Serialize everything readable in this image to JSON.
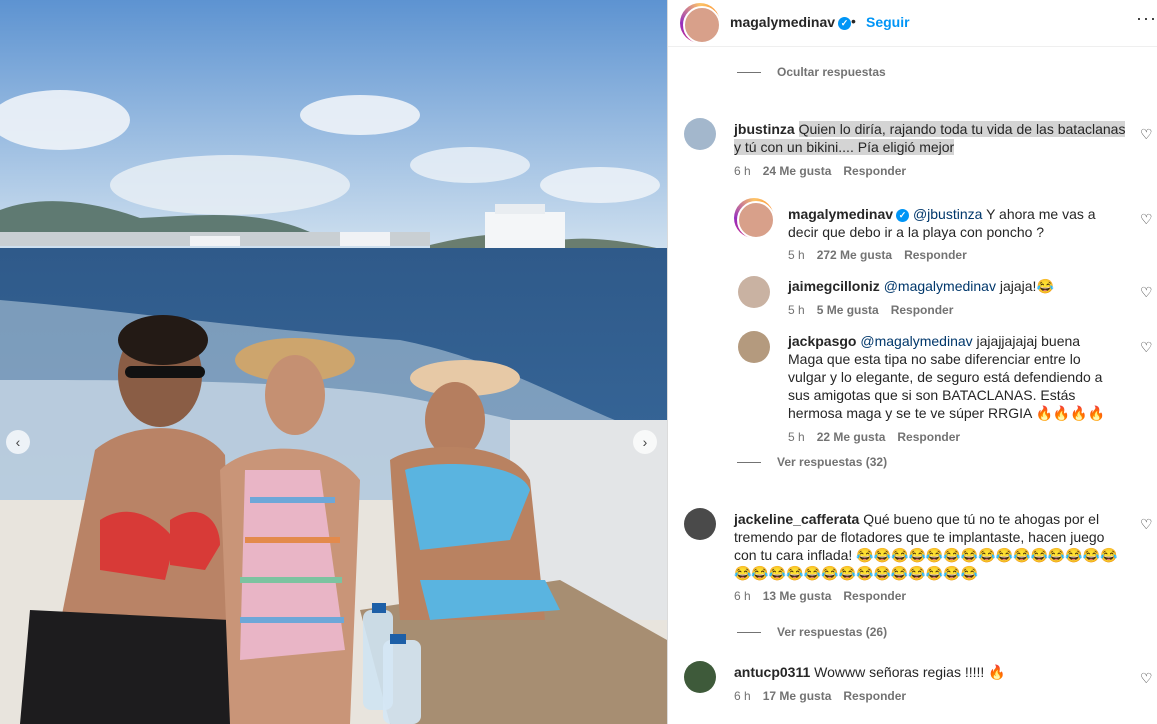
{
  "header": {
    "username": "magalymedinav",
    "dot": "•",
    "follow": "Seguir",
    "more": "···"
  },
  "hide_replies": "Ocultar respuestas",
  "comments": [
    {
      "username": "jbustinza",
      "text": "Quien lo diría, rajando toda tu vida de las bataclanas y tú con un bikini.... Pía eligió mejor",
      "time": "6 h",
      "likes": "24 Me gusta",
      "reply": "Responder"
    },
    {
      "username": "magalymedinav",
      "mention": "@jbustinza",
      "text": "Y ahora me vas a decir que debo ir a la playa con poncho ?",
      "time": "5 h",
      "likes": "272 Me gusta",
      "reply": "Responder"
    },
    {
      "username": "jaimegcilloniz",
      "mention": "@magalymedinav",
      "text": "jajaja!😂",
      "time": "5 h",
      "likes": "5 Me gusta",
      "reply": "Responder"
    },
    {
      "username": "jackpasgo",
      "mention": "@magalymedinav",
      "text": "jajajjajajaj buena Maga que esta tipa no sabe diferenciar entre lo vulgar y lo elegante, de seguro está defendiendo a sus amigotas que si son BATACLANAS. Estás hermosa maga y se te ve súper RRGIA 🔥🔥🔥🔥",
      "time": "5 h",
      "likes": "22 Me gusta",
      "reply": "Responder",
      "view_replies": "Ver respuestas (32)"
    },
    {
      "username": "jackeline_cafferata",
      "text": "Qué bueno que tú no te ahogas por el tremendo par de flotadores que te implantaste, hacen juego con tu cara inflada! 😂😂😂😂😂😂😂😂😂😂😂😂😂😂😂😂😂😂😂😂😂😂😂😂😂😂😂😂😂",
      "time": "6 h",
      "likes": "13 Me gusta",
      "reply": "Responder",
      "view_replies": "Ver respuestas (26)"
    },
    {
      "username": "antucp0311",
      "text": "Wowww señoras regias !!!!! 🔥",
      "time": "6 h",
      "likes": "17 Me gusta",
      "reply": "Responder"
    }
  ],
  "icons": {
    "heart": "♡",
    "verified": "✓",
    "prev": "‹",
    "next": "›"
  },
  "colors": {
    "link": "#0095f6",
    "mention": "#00376b",
    "muted": "#737373"
  }
}
